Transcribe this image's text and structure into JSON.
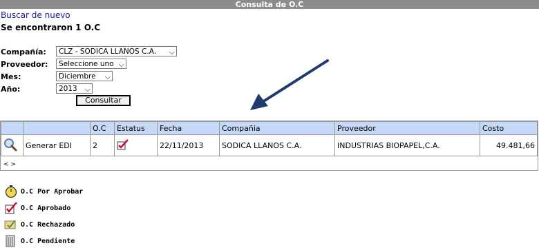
{
  "title": "Consulta de O.C",
  "search_again": "Buscar de nuevo",
  "found_text": "Se encontraron 1 O.C",
  "form": {
    "company_label": "Compañía:",
    "company_value": "CLZ - SODICA LLANOS C.A.",
    "provider_label": "Proveedor:",
    "provider_value": "Seleccione uno",
    "month_label": "Mes:",
    "month_value": "Diciembre",
    "year_label": "Año:",
    "year_value": "2013",
    "submit_label": "Consultar"
  },
  "table": {
    "headers": [
      "",
      "",
      "O.C",
      "Estatus",
      "Fecha",
      "Compañia",
      "Proveedor",
      "Costo"
    ],
    "rows": [
      {
        "action": "Generar EDI",
        "oc": "2",
        "status_icon": "approved-icon",
        "fecha": "22/11/2013",
        "compania": "SODICA LLANOS C.A.",
        "proveedor": "INDUSTRIAS BIOPAPEL,C.A.",
        "costo": "49.481,66"
      }
    ],
    "pager": "< >"
  },
  "legend": [
    {
      "icon": "stopwatch-icon",
      "label": "O.C Por Aprobar"
    },
    {
      "icon": "approved-icon",
      "label": "O.C Aprobado"
    },
    {
      "icon": "rejected-icon",
      "label": "O.C Rechazado"
    },
    {
      "icon": "pending-icon",
      "label": "O.C Pendiente"
    }
  ],
  "colors": {
    "titlebar": "#8c8c8c",
    "header_bg": "#c3d9f7",
    "link": "#1a1a8c",
    "arrow": "#1f3a6b"
  }
}
